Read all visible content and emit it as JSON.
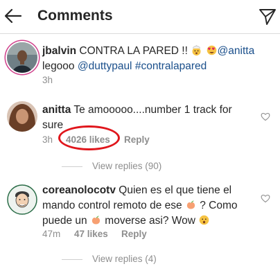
{
  "header": {
    "title": "Comments",
    "back_icon": "back-arrow-icon",
    "send_icon": "direct-send-icon"
  },
  "caption": {
    "username": "jbalvin",
    "text": "CONTRA LA PARED !!",
    "mention_1": "@anitta",
    "line2_text": "legooo",
    "mention_2": "@duttypaul",
    "hashtag": "#contralapared",
    "time": "3h",
    "emojis": [
      "exploding-head-emoji",
      "heart-eyes-emoji"
    ]
  },
  "comments": [
    {
      "username": "anitta",
      "line1": "Te amooooo....number 1 track for",
      "line2": "sure",
      "time": "3h",
      "likes": "4026 likes",
      "reply": "Reply",
      "view_replies": "View replies (90)"
    },
    {
      "username": "coreanolocotv",
      "line1": "Quien es el que tiene el",
      "line2a": "mando control remoto de ese",
      "line2b": "? Como",
      "line3a": "puede un",
      "line3b": "moverse asi? Wow",
      "time": "47m",
      "likes": "47 likes",
      "reply": "Reply",
      "view_replies": "View replies (4)",
      "emojis": [
        "peach-emoji",
        "peach-emoji",
        "hushed-face-emoji"
      ]
    }
  ],
  "colors": {
    "link": "#1a4f8b",
    "highlight": "#e0161c",
    "muted": "#8e8e8e",
    "story_ring": "#cf3f8b"
  }
}
